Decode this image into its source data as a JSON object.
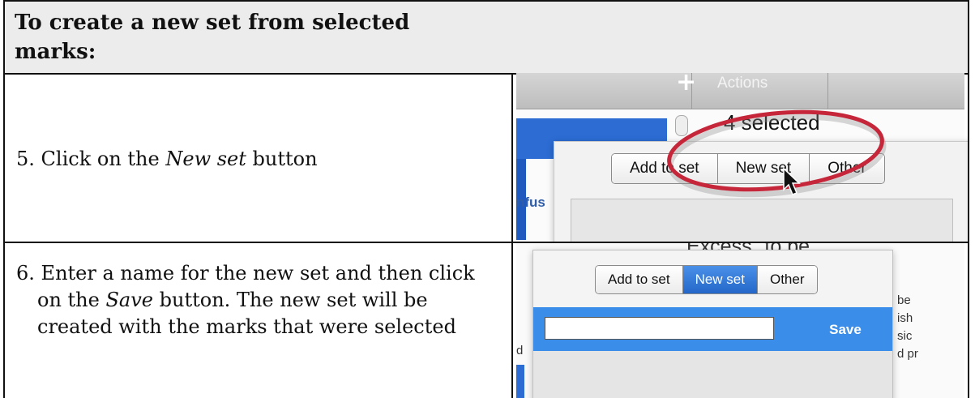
{
  "header": {
    "title": "To create a new set from selected marks:"
  },
  "step5": {
    "number": "5.",
    "before": "Click on the",
    "emph": "New set",
    "after": "button"
  },
  "step6": {
    "number": "6.",
    "before": "Enter a name for the new set and then click on the",
    "emph": "Save",
    "after": "button. The new set will be created with the marks that were selected"
  },
  "screenshot1": {
    "toolbar_plus": "+",
    "toolbar_actions": "Actions",
    "selected_text": "4 selected",
    "side_text": "nfus",
    "segments": [
      "Add to set",
      "New set",
      "Other"
    ],
    "highlight_color": "#c6263a"
  },
  "screenshot2": {
    "background_text": "Excess \"to be\"",
    "left_fragment": "d",
    "right_fragments": [
      "be",
      "ish",
      "sic",
      "d pr"
    ],
    "segments": [
      "Add to set",
      "New set",
      "Other"
    ],
    "active_segment": "New set",
    "input_value": "",
    "save_label": "Save",
    "accent_color": "#3a8de8"
  }
}
